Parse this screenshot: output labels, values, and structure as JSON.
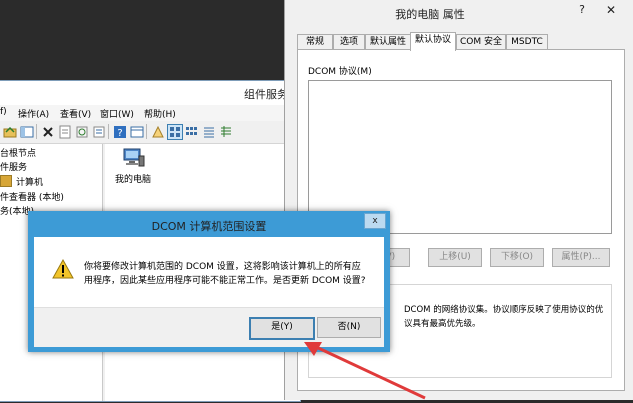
{
  "component_services": {
    "title": "组件服务",
    "menu": [
      "f)",
      "操作(A)",
      "查看(V)",
      "窗口(W)",
      "帮助(H)"
    ],
    "tree": [
      "台根节点",
      "件服务",
      "计算机",
      "件查看器 (本地)",
      "务(本地)"
    ],
    "content_item": "我的电脑"
  },
  "properties": {
    "title": "我的电脑 属性",
    "help": "?",
    "close": "✕",
    "tabs": [
      "常规",
      "选项",
      "默认属性",
      "默认协议",
      "COM 安全",
      "MSDTC"
    ],
    "active_tab": "默认协议",
    "protocols_label": "DCOM 协议(M)",
    "buttons": [
      "移(V)",
      "上移(U)",
      "下移(O)",
      "属性(P)..."
    ],
    "description_line1": "DCOM 的网络协议集。协议顺序反映了使用协议的优",
    "description_line2": "议具有最高优先级。"
  },
  "confirm": {
    "title": "DCOM 计算机范围设置",
    "close": "x",
    "message_line1": "你将要修改计算机范围的 DCOM 设置，这将影响该计算机上的所有应",
    "message_line2": "用程序，因此某些应用程序可能不能正常工作。是否更新 DCOM 设置?",
    "yes": "是(Y)",
    "no": "否(N)"
  },
  "colors": {
    "dialog_frame": "#3d9bd6",
    "arrow": "#e03a3a",
    "warning": "#f2c42a"
  }
}
